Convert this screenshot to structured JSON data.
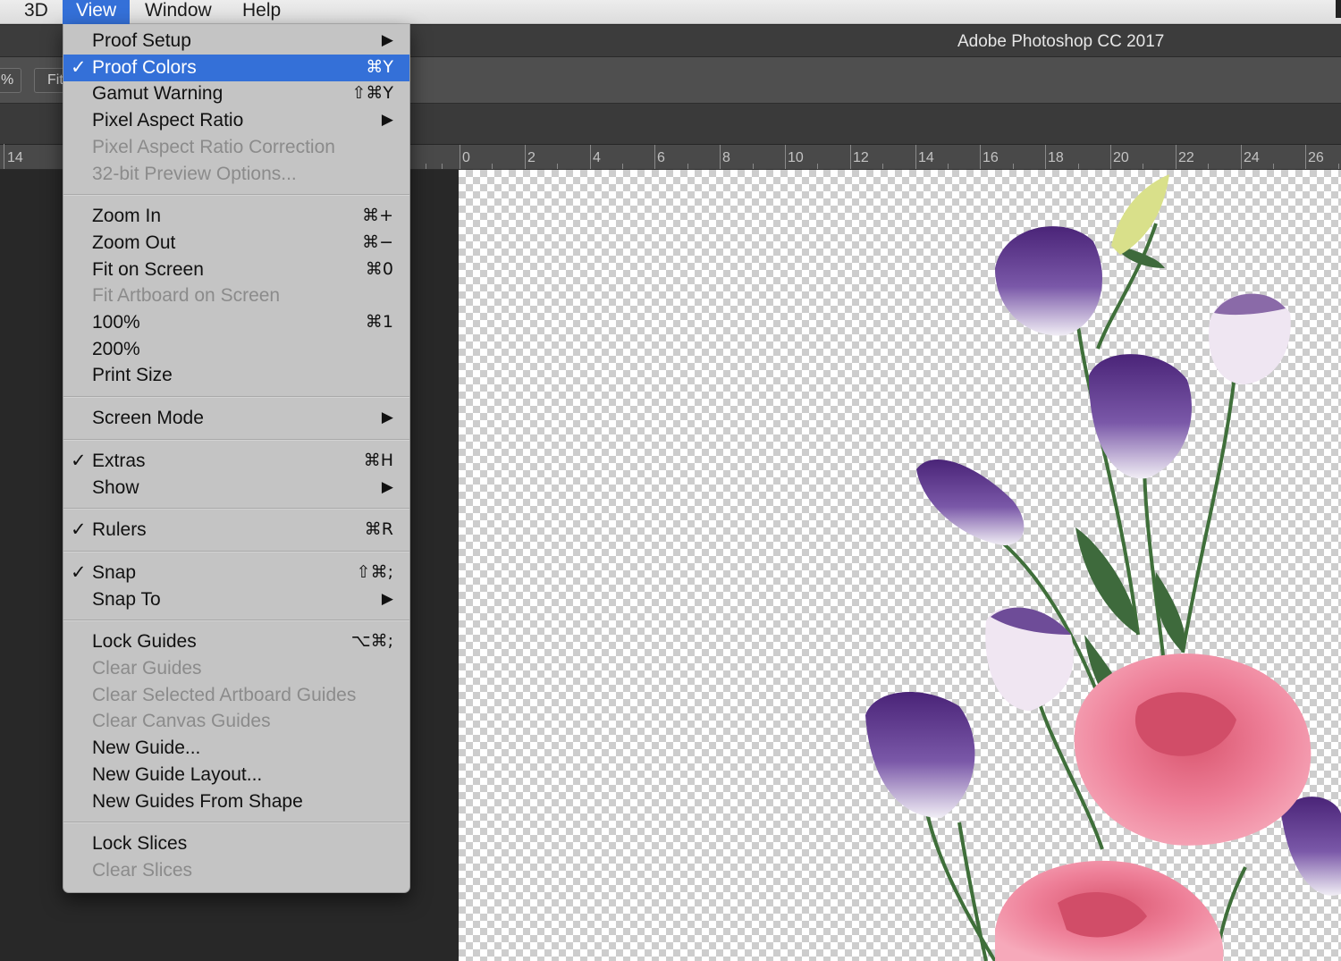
{
  "menubar": {
    "items": [
      "3D",
      "View",
      "Window",
      "Help"
    ],
    "active": "View"
  },
  "app": {
    "title": "Adobe Photoshop CC 2017",
    "zoom_fragment": "%",
    "fit_button": "Fit"
  },
  "ruler": {
    "left_label": "14",
    "labels": [
      "0",
      "2",
      "4",
      "6",
      "8",
      "10",
      "12",
      "14",
      "16",
      "18",
      "20",
      "22",
      "24",
      "26"
    ]
  },
  "view_menu": {
    "items": [
      {
        "label": "Proof Setup",
        "submenu": true
      },
      {
        "label": "Proof Colors",
        "checked": true,
        "shortcut": "⌘Y",
        "highlight": true
      },
      {
        "label": "Gamut Warning",
        "shortcut": "⇧⌘Y"
      },
      {
        "label": "Pixel Aspect Ratio",
        "submenu": true
      },
      {
        "label": "Pixel Aspect Ratio Correction",
        "disabled": true
      },
      {
        "label": "32-bit Preview Options...",
        "disabled": true
      },
      {
        "separator": true
      },
      {
        "label": "Zoom In",
        "shortcut": "⌘+"
      },
      {
        "label": "Zoom Out",
        "shortcut": "⌘−"
      },
      {
        "label": "Fit on Screen",
        "shortcut": "⌘0"
      },
      {
        "label": "Fit Artboard on Screen",
        "disabled": true
      },
      {
        "label": "100%",
        "shortcut": "⌘1"
      },
      {
        "label": "200%"
      },
      {
        "label": "Print Size"
      },
      {
        "separator": true
      },
      {
        "label": "Screen Mode",
        "submenu": true
      },
      {
        "separator": true
      },
      {
        "label": "Extras",
        "checked": true,
        "shortcut": "⌘H"
      },
      {
        "label": "Show",
        "submenu": true
      },
      {
        "separator": true
      },
      {
        "label": "Rulers",
        "checked": true,
        "shortcut": "⌘R"
      },
      {
        "separator": true
      },
      {
        "label": "Snap",
        "checked": true,
        "shortcut": "⇧⌘;"
      },
      {
        "label": "Snap To",
        "submenu": true
      },
      {
        "separator": true
      },
      {
        "label": "Lock Guides",
        "shortcut": "⌥⌘;"
      },
      {
        "label": "Clear Guides",
        "disabled": true
      },
      {
        "label": "Clear Selected Artboard Guides",
        "disabled": true
      },
      {
        "label": "Clear Canvas Guides",
        "disabled": true
      },
      {
        "label": "New Guide..."
      },
      {
        "label": "New Guide Layout..."
      },
      {
        "label": "New Guides From Shape"
      },
      {
        "separator": true
      },
      {
        "label": "Lock Slices"
      },
      {
        "label": "Clear Slices",
        "disabled": true
      }
    ]
  },
  "colors": {
    "highlight": "#3470d8",
    "menu_bg": "#c4c4c4",
    "purple_petal": "#4e2a7a",
    "pink_rose": "#ee7f98",
    "stem": "#3f6f3a"
  },
  "canvas": {
    "content": "transparent layer with lisianthus and pink rose flowers",
    "icons": [
      "checkmark-icon",
      "submenu-arrow-icon"
    ]
  }
}
